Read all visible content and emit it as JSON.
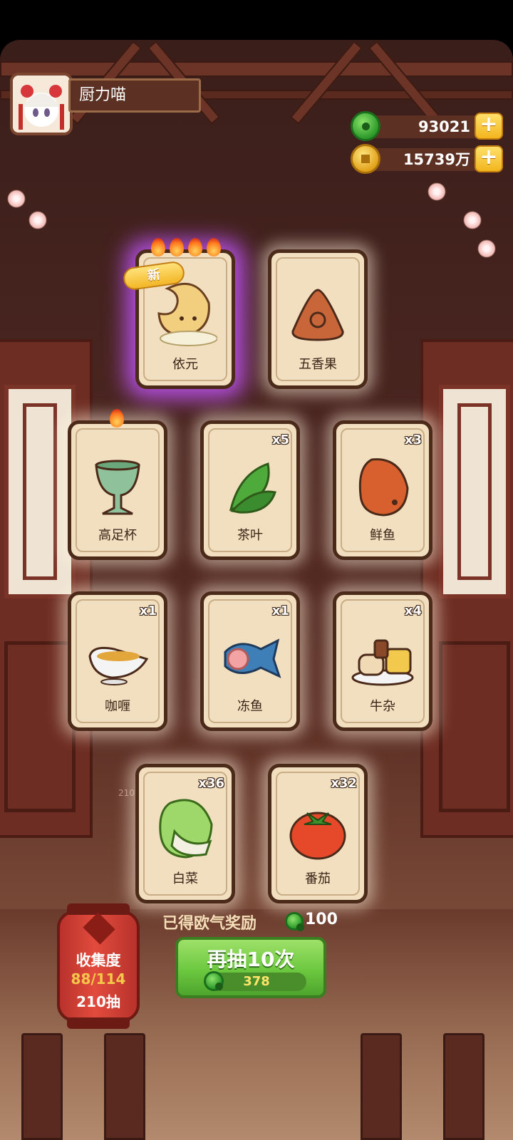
{
  "header": {
    "player_name": "厨力喵",
    "avatar_icon": "chef-girl-avatar",
    "jade": {
      "value": "93021",
      "icon": "jade-coin-icon",
      "add_label": "+"
    },
    "gold": {
      "value": "15739万",
      "icon": "gold-coin-icon",
      "add_label": "+"
    }
  },
  "cards_row1": [
    {
      "name": "依元",
      "count": "",
      "badge": "新",
      "flames": 4,
      "rarity_glow": "#c456ff",
      "icon": "moon-creature-icon"
    },
    {
      "name": "五香果",
      "count": "",
      "icon": "spiced-triangle-icon"
    }
  ],
  "cards_row2": [
    {
      "name": "高足杯",
      "count": "",
      "flames": 1,
      "icon": "goblet-icon"
    },
    {
      "name": "茶叶",
      "count": "x5",
      "icon": "tea-leaf-icon"
    },
    {
      "name": "鲜鱼",
      "count": "x3",
      "icon": "fresh-fish-icon"
    }
  ],
  "cards_row3": [
    {
      "name": "咖喱",
      "count": "x1",
      "icon": "curry-boat-icon"
    },
    {
      "name": "冻鱼",
      "count": "x1",
      "icon": "frozen-fish-icon"
    },
    {
      "name": "牛杂",
      "count": "x4",
      "icon": "beef-offal-icon"
    }
  ],
  "cards_row4": [
    {
      "name": "白菜",
      "count": "x36",
      "icon": "cabbage-icon"
    },
    {
      "name": "番茄",
      "count": "x32",
      "icon": "tomato-icon"
    }
  ],
  "reward": {
    "label": "已得欧气奖励",
    "value": "100",
    "icon": "jade-coin-icon"
  },
  "redraw_button": {
    "label": "再抽10次",
    "cost": "378",
    "cost_icon": "jade-coin-icon"
  },
  "collection": {
    "title": "收集度",
    "progress": "88/114",
    "draws": "210抽"
  },
  "background_tag": "210抽",
  "colors": {
    "button_green": "#6cc83f",
    "lantern_red": "#e24b3d",
    "card_bg": "#f1dfbf",
    "glow_purple": "#c456ff"
  }
}
